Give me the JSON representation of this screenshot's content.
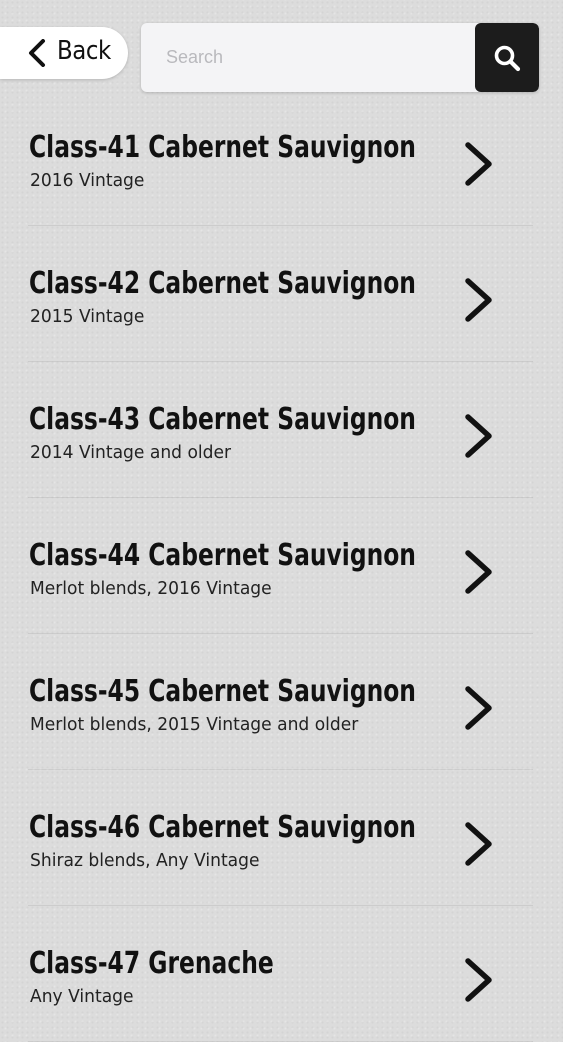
{
  "header": {
    "back_label": "Back",
    "search_placeholder": "Search",
    "search_value": ""
  },
  "icons": {
    "back": "chevron-left-icon",
    "search": "magnifier-icon",
    "row": "chevron-right-icon"
  },
  "colors": {
    "background": "#dcdcdc",
    "search_button": "#1c1c1c",
    "text": "#111111"
  },
  "items": [
    {
      "title": "Class-41 Cabernet Sauvignon",
      "subtitle": "2016 Vintage"
    },
    {
      "title": "Class-42 Cabernet Sauvignon",
      "subtitle": "2015 Vintage"
    },
    {
      "title": "Class-43 Cabernet Sauvignon",
      "subtitle": "2014 Vintage and older"
    },
    {
      "title": "Class-44 Cabernet Sauvignon",
      "subtitle": "Merlot blends, 2016 Vintage"
    },
    {
      "title": "Class-45 Cabernet Sauvignon",
      "subtitle": "Merlot blends, 2015 Vintage and older"
    },
    {
      "title": "Class-46 Cabernet Sauvignon",
      "subtitle": "Shiraz blends, Any Vintage"
    },
    {
      "title": "Class-47 Grenache",
      "subtitle": "Any Vintage"
    }
  ]
}
